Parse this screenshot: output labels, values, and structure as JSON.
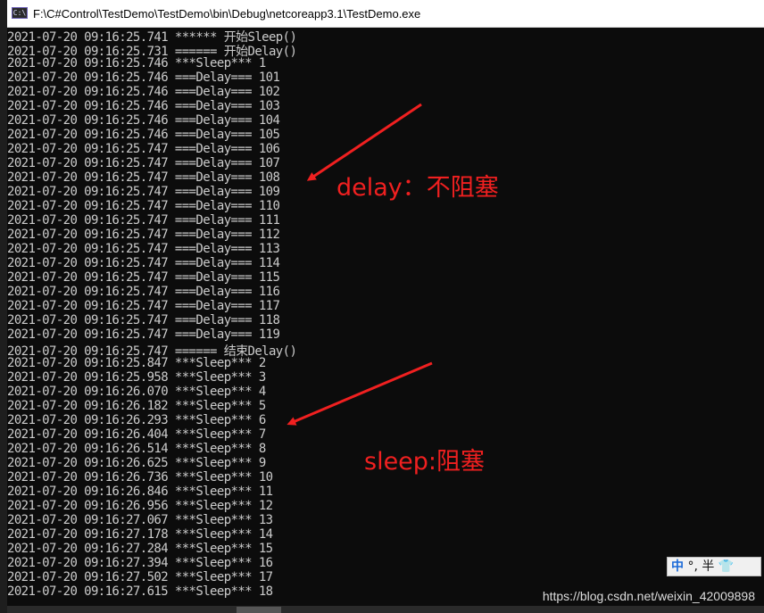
{
  "window": {
    "title": "F:\\C#Control\\TestDemo\\TestDemo\\bin\\Debug\\netcoreapp3.1\\TestDemo.exe",
    "icon": "console-app-icon"
  },
  "console": {
    "lines": [
      "2021-07-20 09:16:25.741 ****** 开始Sleep()",
      "2021-07-20 09:16:25.731 ====== 开始Delay()",
      "2021-07-20 09:16:25.746 ***Sleep*** 1",
      "2021-07-20 09:16:25.746 ===Delay=== 101",
      "2021-07-20 09:16:25.746 ===Delay=== 102",
      "2021-07-20 09:16:25.746 ===Delay=== 103",
      "2021-07-20 09:16:25.746 ===Delay=== 104",
      "2021-07-20 09:16:25.746 ===Delay=== 105",
      "2021-07-20 09:16:25.747 ===Delay=== 106",
      "2021-07-20 09:16:25.747 ===Delay=== 107",
      "2021-07-20 09:16:25.747 ===Delay=== 108",
      "2021-07-20 09:16:25.747 ===Delay=== 109",
      "2021-07-20 09:16:25.747 ===Delay=== 110",
      "2021-07-20 09:16:25.747 ===Delay=== 111",
      "2021-07-20 09:16:25.747 ===Delay=== 112",
      "2021-07-20 09:16:25.747 ===Delay=== 113",
      "2021-07-20 09:16:25.747 ===Delay=== 114",
      "2021-07-20 09:16:25.747 ===Delay=== 115",
      "2021-07-20 09:16:25.747 ===Delay=== 116",
      "2021-07-20 09:16:25.747 ===Delay=== 117",
      "2021-07-20 09:16:25.747 ===Delay=== 118",
      "2021-07-20 09:16:25.747 ===Delay=== 119",
      "2021-07-20 09:16:25.747 ====== 结束Delay()",
      "2021-07-20 09:16:25.847 ***Sleep*** 2",
      "2021-07-20 09:16:25.958 ***Sleep*** 3",
      "2021-07-20 09:16:26.070 ***Sleep*** 4",
      "2021-07-20 09:16:26.182 ***Sleep*** 5",
      "2021-07-20 09:16:26.293 ***Sleep*** 6",
      "2021-07-20 09:16:26.404 ***Sleep*** 7",
      "2021-07-20 09:16:26.514 ***Sleep*** 8",
      "2021-07-20 09:16:26.625 ***Sleep*** 9",
      "2021-07-20 09:16:26.736 ***Sleep*** 10",
      "2021-07-20 09:16:26.846 ***Sleep*** 11",
      "2021-07-20 09:16:26.956 ***Sleep*** 12",
      "2021-07-20 09:16:27.067 ***Sleep*** 13",
      "2021-07-20 09:16:27.178 ***Sleep*** 14",
      "2021-07-20 09:16:27.284 ***Sleep*** 15",
      "2021-07-20 09:16:27.394 ***Sleep*** 16",
      "2021-07-20 09:16:27.502 ***Sleep*** 17",
      "2021-07-20 09:16:27.615 ***Sleep*** 18"
    ]
  },
  "annotations": {
    "delay": "delay：不阻塞",
    "sleep": "sleep:阻塞",
    "color": "#f02020"
  },
  "ime": {
    "mode": "中",
    "punct": "°,",
    "width": "半",
    "skin_icon": "shirt-icon"
  },
  "watermark": "https://blog.csdn.net/weixin_42009898"
}
